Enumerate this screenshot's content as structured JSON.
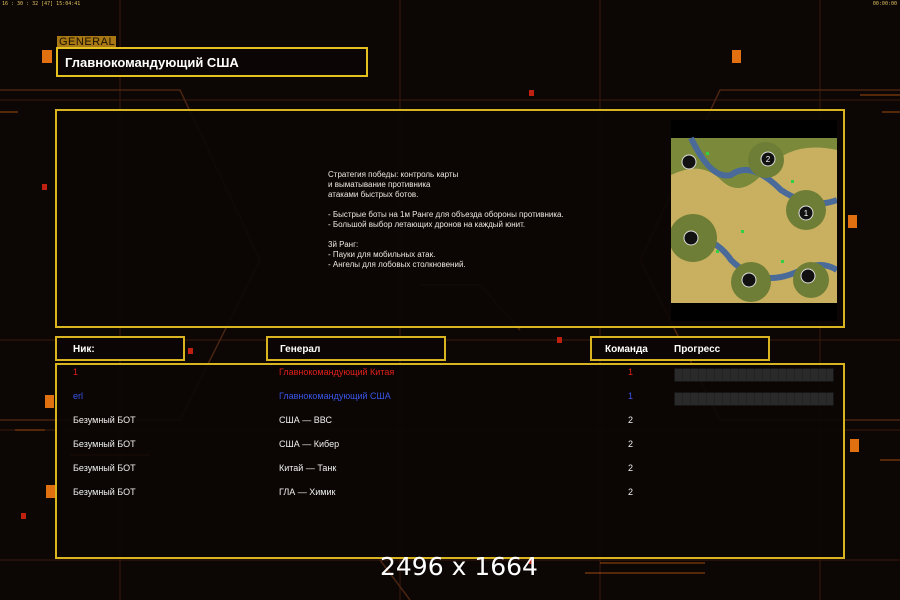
{
  "topbar": {
    "left": "16 : 30 : 32 [47] 15:04:41",
    "right": "00:00:00"
  },
  "general_tag": "GENERAL",
  "title": "Главнокомандующий США",
  "description": "Стратегия победы: контроль карты\nи выматывание противника\nатаками быстрых ботов.\n\n- Быстрые боты на 1м Ранге для объезда обороны противника.\n- Большой выбор летающих дронов на каждый юнит.\n\n3й Ранг:\n- Пауки для мобильных атак.\n- Ангелы для лобовых столкновений.",
  "map": {
    "markers": [
      "2",
      "1"
    ]
  },
  "headers": {
    "nick": "Ник:",
    "general": "Генерал",
    "team": "Команда",
    "progress": "Прогресс"
  },
  "players": [
    {
      "nick": "1",
      "general": "Главнокомандующий Китая",
      "team": "1",
      "color": "#e0201a",
      "progress": true
    },
    {
      "nick": "erl",
      "general": "Главнокомандующий США",
      "team": "1",
      "color": "#3a56e8",
      "progress": true
    },
    {
      "nick": "Безумный БОТ",
      "general": "США — ВВС",
      "team": "2",
      "color": "#f0f0f0",
      "progress": false
    },
    {
      "nick": "Безумный БОТ",
      "general": "США — Кибер",
      "team": "2",
      "color": "#f0f0f0",
      "progress": false
    },
    {
      "nick": "Безумный БОТ",
      "general": "Китай — Танк",
      "team": "2",
      "color": "#f0f0f0",
      "progress": false
    },
    {
      "nick": "Безумный БОТ",
      "general": "ГЛА — Химик",
      "team": "2",
      "color": "#f0f0f0",
      "progress": false
    }
  ],
  "watermark": "2496 x 1664",
  "colors": {
    "frame": "#d8b420",
    "accent": "#e07010",
    "background": "#0c0705"
  }
}
